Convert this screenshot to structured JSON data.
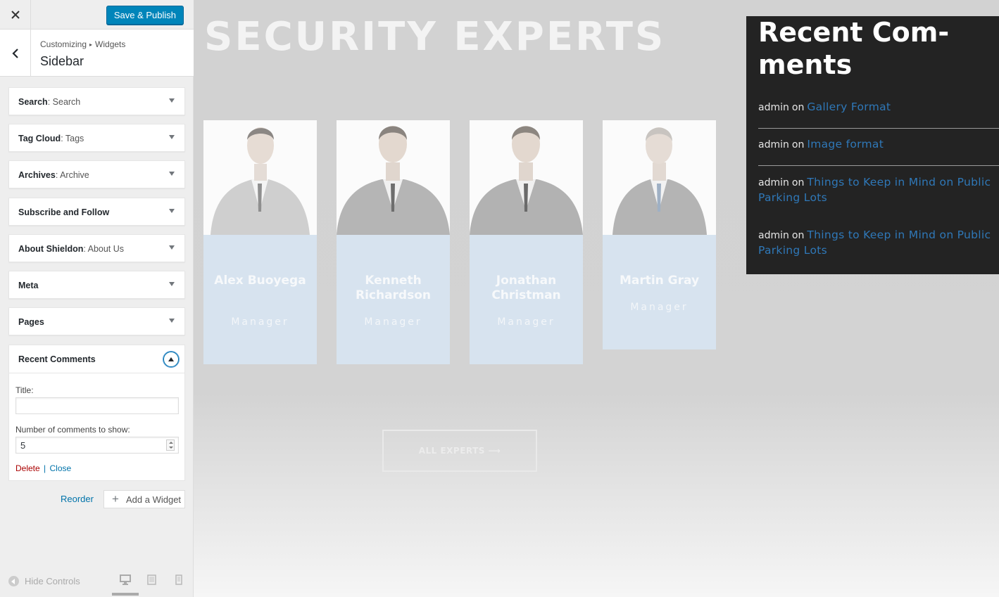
{
  "customizer": {
    "close_icon": "close-icon",
    "save_label": "Save & Publish",
    "breadcrumb": {
      "parent": "Customizing",
      "sep": "▸",
      "child": "Widgets"
    },
    "section_title": "Sidebar",
    "widgets": [
      {
        "title": "Search",
        "sub": ": Search"
      },
      {
        "title": "Tag Cloud",
        "sub": ": Tags"
      },
      {
        "title": "Archives",
        "sub": ": Archive"
      },
      {
        "title": "Subscribe and Follow",
        "sub": ""
      },
      {
        "title": "About Shieldon",
        "sub": ": About Us"
      },
      {
        "title": "Meta",
        "sub": ""
      },
      {
        "title": "Pages",
        "sub": ""
      }
    ],
    "recent_comments_widget": {
      "title": "Recent Comments",
      "title_label": "Title:",
      "title_value": "",
      "number_label": "Number of comments to show:",
      "number_value": "5",
      "delete_label": "Delete",
      "divider": "|",
      "close_label": "Close"
    },
    "reorder_label": "Reorder",
    "add_widget_label": "Add a Widget",
    "hide_controls_label": "Hide Controls",
    "accent_color": "#0085ba"
  },
  "preview": {
    "heading": "SECURITY EXPERTS",
    "team": [
      {
        "name": "Alex Buoyega",
        "role": "Manager"
      },
      {
        "name": "Kenneth Richardson",
        "role": "Manager"
      },
      {
        "name": "Jonathan Christman",
        "role": "Manager"
      },
      {
        "name": "Martin Gray",
        "role": "Manager"
      }
    ],
    "all_experts_label": "ALL EXPERTS ⟶",
    "recent_comments": {
      "title": "Recent Com-ments",
      "items": [
        {
          "author": "admin",
          "on": "on",
          "post": "Gallery Format"
        },
        {
          "author": "admin",
          "on": "on",
          "post": "Image format"
        },
        {
          "author": "admin",
          "on": "on",
          "post": "Things to Keep in Mind on Public Parking Lots"
        },
        {
          "author": "admin",
          "on": "on",
          "post": "Things to Keep in Mind on Public Parking Lots"
        }
      ],
      "link_color": "#2f78b8"
    }
  }
}
